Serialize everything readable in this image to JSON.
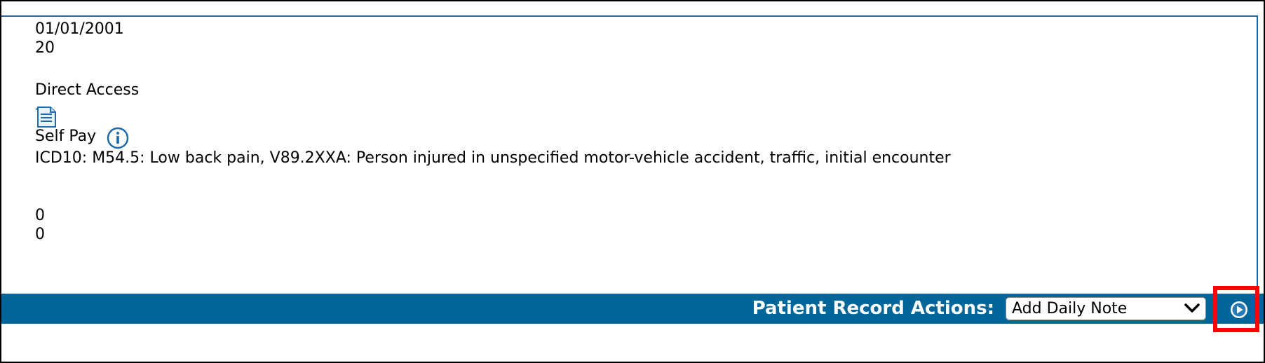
{
  "record": {
    "date": "01/01/2001",
    "number": "20",
    "access_type": "Direct Access",
    "document_icon": "document-icon",
    "payer": "Self Pay",
    "info_icon": "info-icon",
    "diagnosis": "ICD10: M54.5: Low back pain, V89.2XXA: Person injured in unspecified motor-vehicle accident, traffic, initial encounter",
    "value_1": "0",
    "value_2": "0"
  },
  "actions": {
    "label": "Patient Record Actions:",
    "selected": "Add Daily Note",
    "chevron_icon": "chevron-down-icon",
    "go_icon": "play-circle-icon",
    "bar_color": "#006699",
    "highlight_color": "#ff0000"
  }
}
